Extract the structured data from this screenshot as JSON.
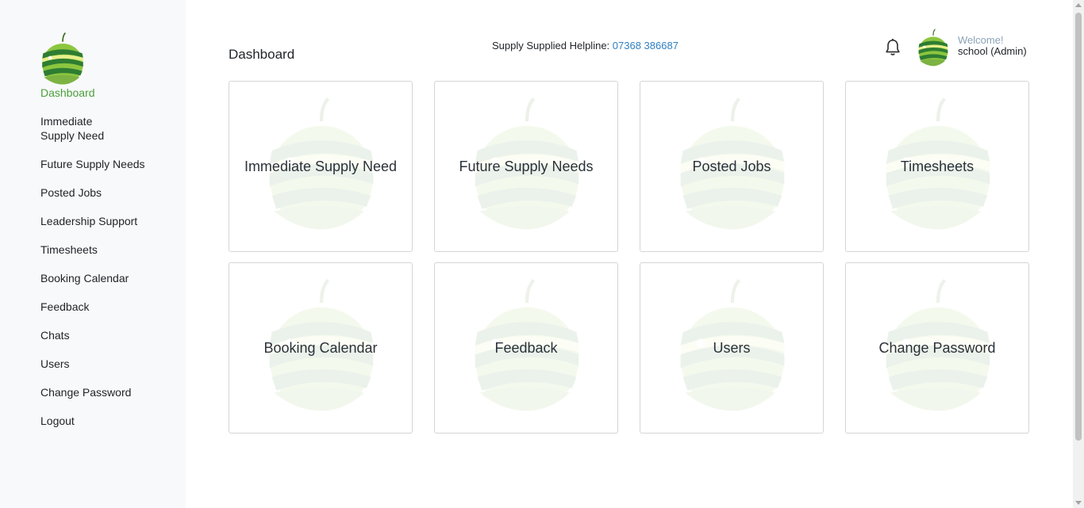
{
  "sidebar": {
    "items": [
      {
        "label": "Dashboard",
        "active": true
      },
      {
        "label": "Immediate Supply Need"
      },
      {
        "label": "Future Supply Needs"
      },
      {
        "label": "Posted Jobs"
      },
      {
        "label": "Leadership Support"
      },
      {
        "label": "Timesheets"
      },
      {
        "label": "Booking Calendar"
      },
      {
        "label": "Feedback"
      },
      {
        "label": "Chats"
      },
      {
        "label": "Users"
      },
      {
        "label": "Change Password"
      },
      {
        "label": "Logout"
      }
    ]
  },
  "header": {
    "title": "Dashboard",
    "helpline_label": "Supply Supplied Helpline:",
    "helpline_number": "07368 386687",
    "welcome": "Welcome!",
    "user": "school (Admin)"
  },
  "tiles": [
    {
      "label": "Immediate Supply Need"
    },
    {
      "label": "Future Supply Needs"
    },
    {
      "label": "Posted Jobs"
    },
    {
      "label": "Timesheets"
    },
    {
      "label": "Booking Calendar"
    },
    {
      "label": "Feedback"
    },
    {
      "label": "Users"
    },
    {
      "label": "Change Password"
    }
  ],
  "icons": {
    "logo": "apple-logo-icon",
    "bell": "bell-icon",
    "avatar": "apple-avatar-icon"
  },
  "colors": {
    "accent_green": "#4a9e3a",
    "link_blue": "#2f7fc1",
    "sidebar_bg": "#f8f9fa"
  }
}
